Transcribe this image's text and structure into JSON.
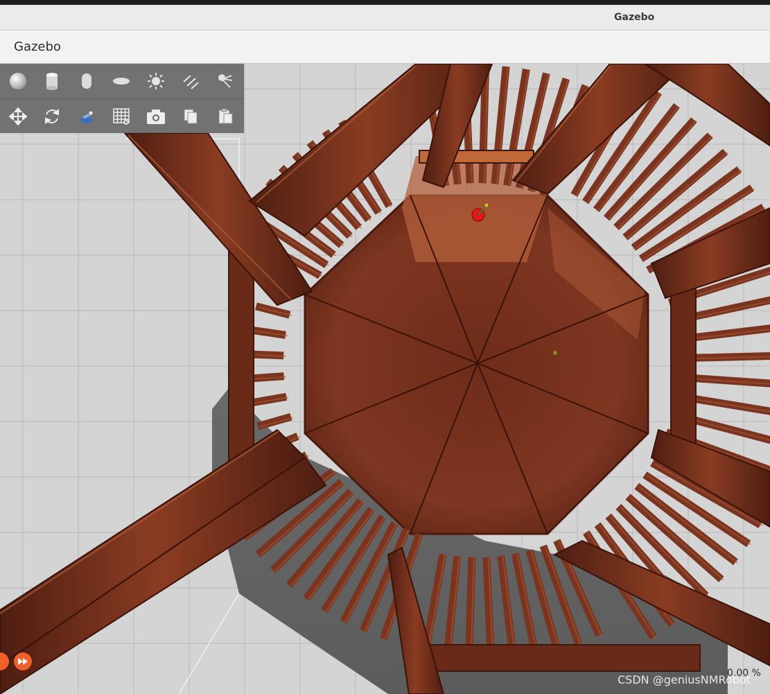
{
  "window": {
    "title": "Gazebo"
  },
  "menubar": {
    "app_name": "Gazebo"
  },
  "toolbar": {
    "row1": [
      {
        "name": "sphere-shape-icon",
        "tooltip": ""
      },
      {
        "name": "cylinder-shape-icon",
        "tooltip": ""
      },
      {
        "name": "capsule-shape-icon",
        "tooltip": ""
      },
      {
        "name": "ellipsoid-shape-icon",
        "tooltip": ""
      },
      {
        "name": "point-light-icon",
        "tooltip": ""
      },
      {
        "name": "directional-light-icon",
        "tooltip": ""
      },
      {
        "name": "spot-light-icon",
        "tooltip": ""
      }
    ],
    "row2": [
      {
        "name": "translate-mode-icon"
      },
      {
        "name": "rotate-mode-icon"
      },
      {
        "name": "scale-mode-icon"
      },
      {
        "name": "grid-icon"
      },
      {
        "name": "screenshot-camera-icon"
      },
      {
        "name": "copy-icon"
      },
      {
        "name": "paste-icon"
      }
    ]
  },
  "playback": {
    "step_icon": "fast-forward-icon"
  },
  "status": {
    "real_time_factor": "0.00 %"
  },
  "watermark": {
    "text": "CSDN @geniusNMRobot"
  },
  "colors": {
    "wood_dark": "#5a2416",
    "wood_mid": "#7a3420",
    "wood_light": "#9a4a2a",
    "accent_orange": "#f0612a",
    "ground": "#d4d4d4",
    "toolbar_bg": "#696969"
  }
}
